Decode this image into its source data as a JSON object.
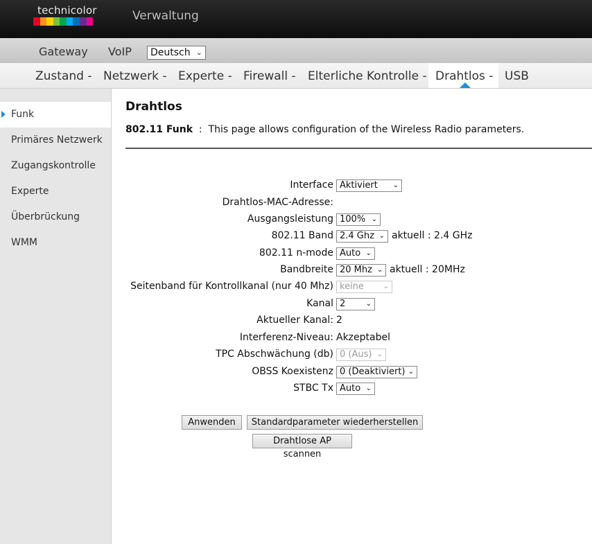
{
  "brand": {
    "logo_text": "technicolor",
    "logo_colors": [
      "#e4002b",
      "#f7941d",
      "#ffd200",
      "#7ac143",
      "#00a651",
      "#00aeef",
      "#0072bc",
      "#662d91",
      "#ec008c"
    ],
    "app_title": "Verwaltung"
  },
  "topnav": {
    "gateway": "Gateway",
    "voip": "VoIP",
    "language": "Deutsch"
  },
  "mainnav": {
    "items": [
      "Zustand -",
      "Netzwerk -",
      "Experte -",
      "Firewall -",
      "Elterliche Kontrolle -",
      "Drahtlos -",
      "USB"
    ],
    "active": "Drahtlos -",
    "accent": "#1e90d6"
  },
  "sidebar": {
    "items": [
      "Funk",
      "Primäres Netzwerk",
      "Zugangskontrolle",
      "Experte",
      "Überbrückung",
      "WMM"
    ],
    "active": "Funk"
  },
  "main": {
    "heading": "Drahtlos",
    "desc_title": "802.11 Funk",
    "desc_sep": ":",
    "desc_text": "This page allows configuration of the Wireless Radio parameters."
  },
  "form": {
    "interface_label": "Interface",
    "interface_value": "Aktiviert",
    "mac_label": "Drahtlos-MAC-Adresse:",
    "power_label": "Ausgangsleistung",
    "power_value": "100%",
    "band_label": "802.11 Band",
    "band_value": "2.4 Ghz",
    "band_current": "aktuell :  2.4 GHz",
    "nmode_label": "802.11 n-mode",
    "nmode_value": "Auto",
    "bw_label": "Bandbreite",
    "bw_value": "20 Mhz",
    "bw_current": "aktuell :  20MHz",
    "sideband_label": "Seitenband für Kontrollkanal (nur 40 Mhz)",
    "sideband_value": "keine",
    "channel_label": "Kanal",
    "channel_value": "2",
    "cur_channel_label": "Aktueller Kanal:",
    "cur_channel_value": "2",
    "interference_label": "Interferenz-Niveau:",
    "interference_value": "Akzeptabel",
    "tpc_label": "TPC Abschwächung (db)",
    "tpc_value": "0 (Aus)",
    "obss_label": "OBSS Koexistenz",
    "obss_value": "0 (Deaktiviert)",
    "stbc_label": "STBC Tx",
    "stbc_value": "Auto"
  },
  "buttons": {
    "apply": "Anwenden",
    "restore": "Standardparameter wiederherstellen",
    "scan": "Drahtlose AP scannen"
  }
}
